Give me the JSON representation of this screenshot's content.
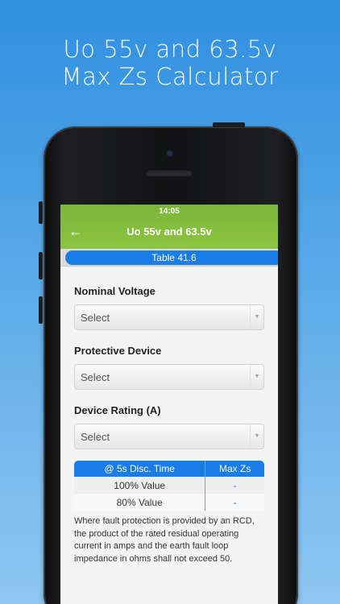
{
  "headline": {
    "line1": "Uo 55v and 63.5v",
    "line2": "Max Zs Calculator"
  },
  "status": {
    "time": "14:05"
  },
  "header": {
    "back_icon": "back-arrow-icon",
    "back_glyph": "←",
    "title": "Uo 55v and 63.5v"
  },
  "table_ref": "Table 41.6",
  "fields": [
    {
      "label": "Nominal Voltage",
      "value": "Select"
    },
    {
      "label": "Protective Device",
      "value": "Select"
    },
    {
      "label": "Device Rating (A)",
      "value": "Select"
    }
  ],
  "results": {
    "headers": [
      "@ 5s Disc. Time",
      "Max Zs"
    ],
    "rows": [
      {
        "label": "100% Value",
        "value": "-"
      },
      {
        "label": "80% Value",
        "value": "-"
      }
    ]
  },
  "note": "Where fault protection is provided by an RCD, the product of the rated residual operating current in amps and the earth fault loop impedance in ohms shall not exceed 50.",
  "colors": {
    "header_green": "#8cc541",
    "accent_blue": "#1a7ce6",
    "background_blue": "#5aaae9"
  }
}
